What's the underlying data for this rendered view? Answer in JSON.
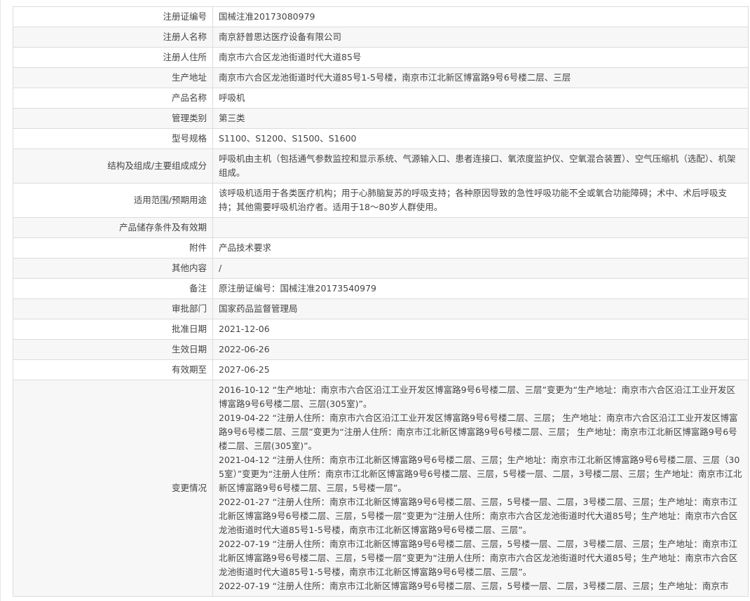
{
  "rows": [
    {
      "label": "注册证编号",
      "value": "国械注准20173080979"
    },
    {
      "label": "注册人名称",
      "value": "南京舒普思达医疗设备有限公司"
    },
    {
      "label": "注册人住所",
      "value": "南京市六合区龙池街道时代大道85号"
    },
    {
      "label": "生产地址",
      "value": "南京市六合区龙池街道时代大道85号1-5号楼，南京市江北新区博富路9号6号楼二层、三层"
    },
    {
      "label": "产品名称",
      "value": "呼吸机"
    },
    {
      "label": "管理类别",
      "value": "第三类"
    },
    {
      "label": "型号规格",
      "value": "S1100、S1200、S1500、S1600"
    },
    {
      "label": "结构及组成/主要组成成分",
      "value": "呼吸机由主机（包括通气参数监控和显示系统、气源输入口、患者连接口、氧浓度监护仪、空氧混合装置）、空气压缩机（选配）、机架组成。"
    },
    {
      "label": "适用范围/预期用途",
      "value": "该呼吸机适用于各类医疗机构；用于心肺脑复苏的呼吸支持；各种原因导致的急性呼吸功能不全或氧合功能障碍；术中、术后呼吸支持；其他需要呼吸机治疗者。适用于18～80岁人群使用。"
    },
    {
      "label": "产品储存条件及有效期",
      "value": ""
    },
    {
      "label": "附件",
      "value": "产品技术要求"
    },
    {
      "label": "其他内容",
      "value": "/"
    },
    {
      "label": "备注",
      "value": "原注册证编号：国械注准20173540979"
    },
    {
      "label": "审批部门",
      "value": "国家药品监督管理局"
    },
    {
      "label": "批准日期",
      "value": "2021-12-06"
    },
    {
      "label": "生效日期",
      "value": "2022-06-26"
    },
    {
      "label": "有效期至",
      "value": "2027-06-25"
    }
  ],
  "changes": {
    "label": "变更情况",
    "entries": [
      "2016-10-12 “生产地址：南京市六合区沿江工业开发区博富路9号6号楼二层、三层”变更为“生产地址：南京市六合区沿江工业开发区博富路9号6号楼二层、三层(305室)”。",
      "2019-04-22 “注册人住所：南京市六合区沿江工业开发区博富路9号6号楼二层、三层； 生产地址：南京市六合区沿江工业开发区博富路9号6号楼二层、三层”变更为“注册人住所：南京市江北新区博富路9号6号楼二层、三层； 生产地址：南京市江北新区博富路9号6号楼二层、三层(305室)”。",
      "2021-04-12 “注册人住所：南京市江北新区博富路9号6号楼二层、三层；生产地址：南京市江北新区博富路9号6号楼二层、三层（305室）”变更为“注册人住所：南京市江北新区博富路9号6号楼二层、三层，5号楼一层、二层，3号楼二层、三层；生产地址：南京市江北新区博富路9号6号楼二层、三层，5号楼一层”。",
      "2022-01-27 “注册人住所：南京市江北新区博富路9号6号楼二层、三层，5号楼一层、二层，3号楼二层、三层；生产地址：南京市江北新区博富路9号6号楼二层、三层，5号楼一层”变更为“注册人住所：南京市六合区龙池街道时代大道85号；生产地址：南京市六合区龙池街道时代大道85号1-5号楼，南京市江北新区博富路9号6号楼二层、三层”。",
      "2022-07-19 “注册人住所：南京市江北新区博富路9号6号楼二层、三层，5号楼一层、二层，3号楼二层、三层；生产地址：南京市江北新区博富路9号6号楼二层、三层，5号楼一层”变更为“注册人住所：南京市六合区龙池街道时代大道85号；生产地址：南京市六合区龙池街道时代大道85号1-5号楼，南京市江北新区博富路9号6号楼二层、三层”。",
      "2022-07-19 “注册人住所：南京市江北新区博富路9号6号楼二层、三层，5号楼一层、二层，3号楼二层、三层；生产地址：南京市"
    ]
  }
}
